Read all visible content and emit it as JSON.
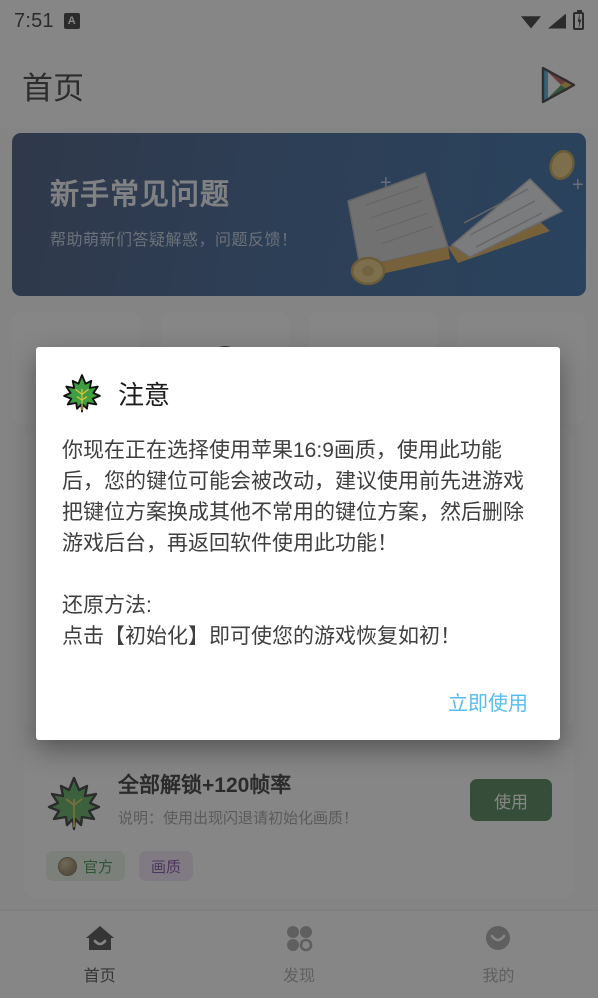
{
  "status_bar": {
    "time": "7:51",
    "indicator_badge": "A",
    "icons": [
      "wifi-icon",
      "signal-icon",
      "battery-charging-icon"
    ]
  },
  "app_bar": {
    "title": "首页",
    "action_icon": "google-play-icon"
  },
  "banner": {
    "title": "新手常见问题",
    "subtitle": "帮助萌新们答疑解惑，问题反馈！",
    "art_icon": "open-book-icon",
    "bg_color": "#14437f"
  },
  "quick_tiles": [
    {
      "icon": "balls-icon",
      "label": ""
    },
    {
      "icon": "donut-icon",
      "label": ""
    },
    {
      "icon": "mouse-icon",
      "label": ""
    },
    {
      "icon": "keyboard-icon",
      "label": ""
    }
  ],
  "cards": [
    {
      "icon": "maple-leaf-icon",
      "title": "",
      "subtitle": "",
      "button_label": "",
      "tags": [
        {
          "label": "官方",
          "icon": "coin-icon",
          "color": "#1f7a2e"
        },
        {
          "label": "画质",
          "icon": "",
          "color": "#6a2f94"
        }
      ]
    },
    {
      "icon": "maple-leaf-icon",
      "title": "全部解锁+120帧率",
      "subtitle": "说明：使用出现闪退请初始化画质！",
      "button_label": "使用",
      "tags": [
        {
          "label": "官方",
          "icon": "coin-icon",
          "color": "#1f7a2e"
        },
        {
          "label": "画质",
          "icon": "",
          "color": "#6a2f94"
        }
      ]
    }
  ],
  "dialog": {
    "icon": "maple-leaf-icon",
    "title": "注意",
    "body": "你现在正在选择使用苹果16:9画质，使用此功能后，您的键位可能会被改动，建议使用前先进游戏把键位方案换成其他不常用的键位方案，然后删除游戏后台，再返回软件使用此功能！\n\n还原方法:\n点击【初始化】即可使您的游戏恢复如初！",
    "confirm_label": "立即使用",
    "confirm_color": "#56bdf0"
  },
  "bottom_nav": {
    "items": [
      {
        "label": "首页",
        "icon": "home-icon",
        "active": true
      },
      {
        "label": "发现",
        "icon": "grid-icon",
        "active": false
      },
      {
        "label": "我的",
        "icon": "profile-icon",
        "active": false
      }
    ]
  }
}
